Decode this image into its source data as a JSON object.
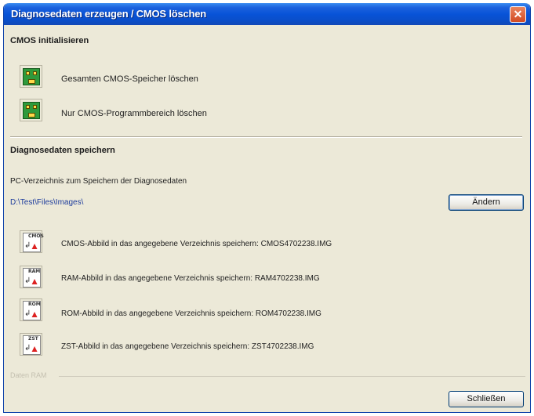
{
  "window": {
    "title": "Diagnosedaten erzeugen / CMOS löschen",
    "close_glyph": "✕"
  },
  "cmos": {
    "heading": "CMOS initialisieren",
    "items": [
      {
        "label": "Gesamten CMOS-Speicher löschen",
        "icon": "chip-icon"
      },
      {
        "label": "Nur CMOS-Programmbereich löschen",
        "icon": "chip-icon"
      }
    ]
  },
  "diagnose": {
    "heading": "Diagnosedaten speichern",
    "dir_label": "PC-Verzeichnis zum Speichern der Diagnosedaten",
    "dir_path": "D:\\Test\\Files\\Images\\",
    "change_button": "Ändern",
    "items": [
      {
        "tag": "CMOS",
        "label": "CMOS-Abbild in das angegebene Verzeichnis speichern: CMOS4702238.IMG"
      },
      {
        "tag": "RAM",
        "label": "RAM-Abbild in das angegebene Verzeichnis speichern: RAM4702238.IMG"
      },
      {
        "tag": "ROM",
        "label": "ROM-Abbild in das angegebene Verzeichnis speichern: ROM4702238.IMG"
      },
      {
        "tag": "ZST",
        "label": "ZST-Abbild in das angegebene Verzeichnis speichern: ZST4702238.IMG"
      }
    ]
  },
  "footer": {
    "group_label": "Daten RAM",
    "close_button": "Schließen"
  },
  "colors": {
    "titlebar": "#0853d8",
    "dialog_bg": "#ece9d8",
    "chip_green": "#2f9a3c",
    "path_blue": "#1d3c9c"
  }
}
